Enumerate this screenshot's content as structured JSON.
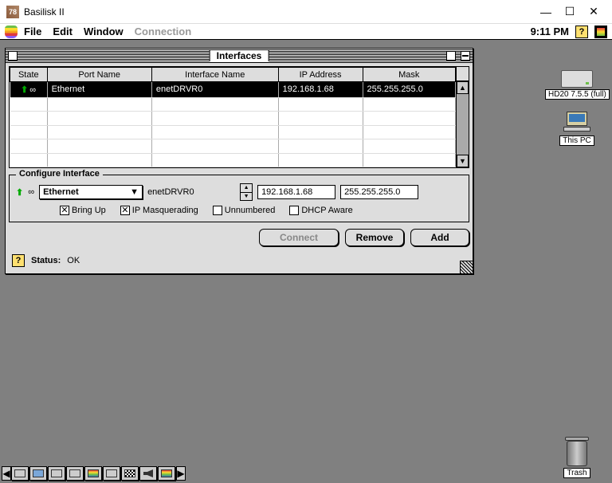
{
  "host_window": {
    "title": "Basilisk II"
  },
  "menubar": {
    "items": [
      "File",
      "Edit",
      "Window",
      "Connection"
    ],
    "disabled_index": 3,
    "time": "9:11 PM"
  },
  "desktop_icons": {
    "hd": "HD20 7.5.5 (full)",
    "pc": "This PC",
    "trash": "Trash"
  },
  "window": {
    "title": "Interfaces",
    "columns": {
      "state": "State",
      "port": "Port Name",
      "interface": "Interface Name",
      "ip": "IP Address",
      "mask": "Mask"
    },
    "rows": [
      {
        "state_up": true,
        "port": "Ethernet",
        "interface": "enetDRVR0",
        "ip": "192.168.1.68",
        "mask": "255.255.255.0",
        "selected": true
      }
    ],
    "group_label": "Configure Interface",
    "port_select": "Ethernet",
    "iface_name": "enetDRVR0",
    "ip_value": "192.168.1.68",
    "mask_value": "255.255.255.0",
    "checks": {
      "bring_up": {
        "label": "Bring Up",
        "checked": true
      },
      "ip_masq": {
        "label": "IP Masquerading",
        "checked": true
      },
      "unnumbered": {
        "label": "Unnumbered",
        "checked": false
      },
      "dhcp": {
        "label": "DHCP Aware",
        "checked": false
      }
    },
    "buttons": {
      "connect": "Connect",
      "remove": "Remove",
      "add": "Add"
    },
    "status_label": "Status:",
    "status_value": "OK"
  }
}
